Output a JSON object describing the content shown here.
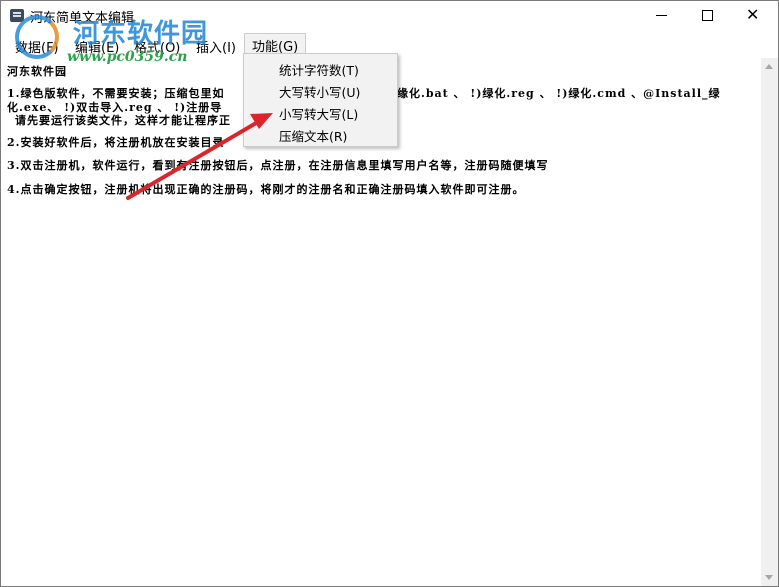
{
  "window": {
    "title": "河东简单文本编辑",
    "icon": "notepad-icon",
    "controls": {
      "minimize": "minimize-icon",
      "maximize": "maximize-icon",
      "close": "✕"
    }
  },
  "watermark": {
    "brand": "河东软件园",
    "url": "www.pc0359.cn"
  },
  "menubar": {
    "items": [
      {
        "label": "数据(F)"
      },
      {
        "label": "编辑(E)"
      },
      {
        "label": "格式(O)"
      },
      {
        "label": "插入(I)"
      },
      {
        "label": "功能(G)",
        "active": true
      }
    ]
  },
  "dropdown": {
    "items": [
      {
        "label": "统计字符数(T)"
      },
      {
        "label": "大写转小写(U)"
      },
      {
        "label": "小写转大写(L)"
      },
      {
        "label": "压缩文本(R)"
      }
    ]
  },
  "document": {
    "lines": [
      "河东软件园",
      "1.绿色版软件，不需要安装；压缩包里如",
      "缘化.bat 、 !)绿化.reg 、 !)绿化.cmd 、@Install_绿",
      "化.exe、 !)双击导入.reg 、 !)注册导",
      "请先要运行该类文件，这样才能让程序正",
      "2.安装好软件后，将注册机放在安装目录",
      "3.双击注册机，软件运行，看到有注册按钮后，点注册，在注册信息里填写用户名等，注册码随便填写",
      "4.点击确定按钮，注册机将出现正确的注册码，将刚才的注册名和正确注册码填入软件即可注册。"
    ]
  },
  "annotation": {
    "arrow_color": "#d9262c",
    "arrow_icon": "red-arrow-icon"
  }
}
